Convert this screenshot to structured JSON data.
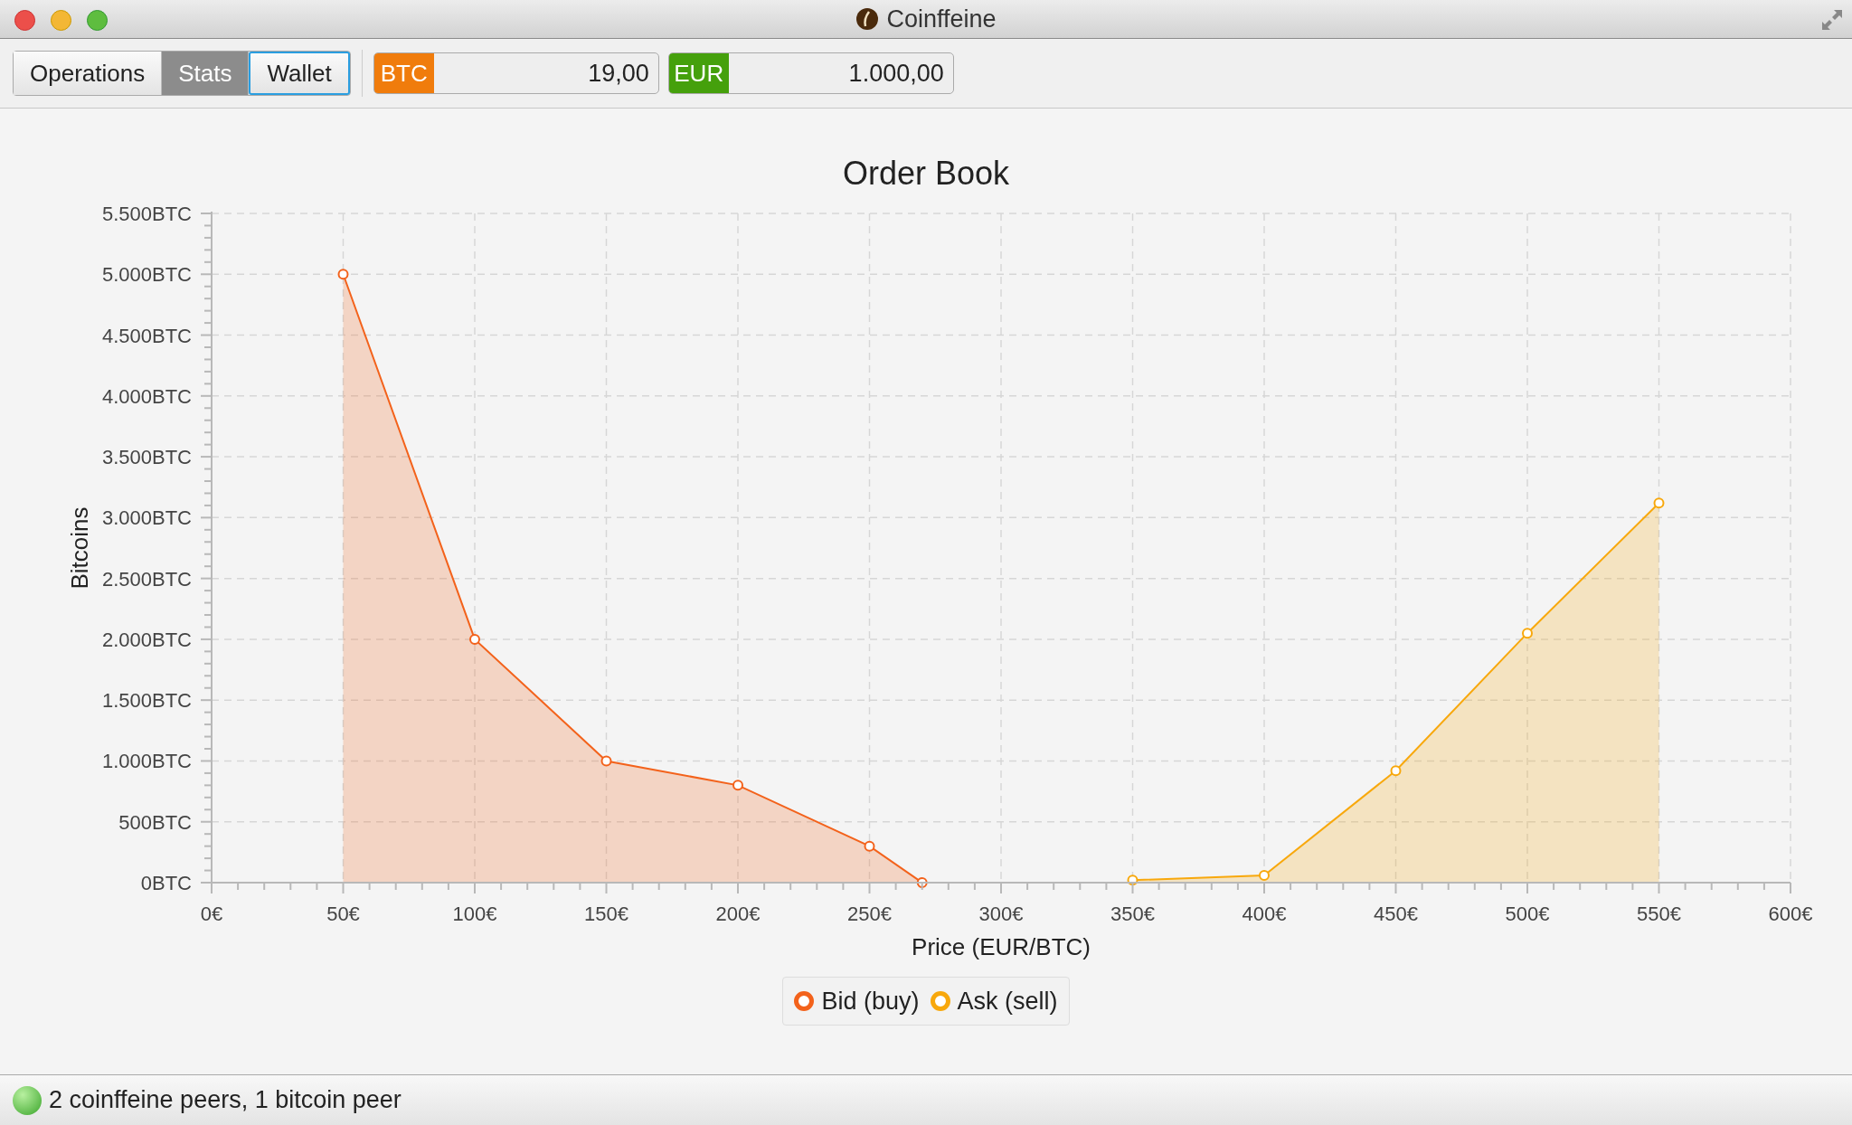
{
  "window": {
    "title": "Coinffeine"
  },
  "tabs": [
    {
      "label": "Operations",
      "selected": false,
      "focused": false
    },
    {
      "label": "Stats",
      "selected": true,
      "focused": false
    },
    {
      "label": "Wallet",
      "selected": false,
      "focused": true
    }
  ],
  "balances": [
    {
      "currency": "BTC",
      "amount": "19,00",
      "color": "#f07c0c"
    },
    {
      "currency": "EUR",
      "amount": "1.000,00",
      "color": "#45a00c"
    }
  ],
  "chart": {
    "chart_data": {
      "type": "area",
      "title": "Order Book",
      "xlabel": "Price (EUR/BTC)",
      "ylabel": "Bitcoins",
      "grid": true,
      "legend": "bottom",
      "xlim": [
        0,
        600
      ],
      "ylim": [
        0,
        5500
      ],
      "xticks": [
        {
          "value": 0,
          "label": "0€"
        },
        {
          "value": 50,
          "label": "50€"
        },
        {
          "value": 100,
          "label": "100€"
        },
        {
          "value": 150,
          "label": "150€"
        },
        {
          "value": 200,
          "label": "200€"
        },
        {
          "value": 250,
          "label": "250€"
        },
        {
          "value": 300,
          "label": "300€"
        },
        {
          "value": 350,
          "label": "350€"
        },
        {
          "value": 400,
          "label": "400€"
        },
        {
          "value": 450,
          "label": "450€"
        },
        {
          "value": 500,
          "label": "500€"
        },
        {
          "value": 550,
          "label": "550€"
        },
        {
          "value": 600,
          "label": "600€"
        }
      ],
      "yticks": [
        {
          "value": 0,
          "label": "0BTC"
        },
        {
          "value": 500,
          "label": "500BTC"
        },
        {
          "value": 1000,
          "label": "1.000BTC"
        },
        {
          "value": 1500,
          "label": "1.500BTC"
        },
        {
          "value": 2000,
          "label": "2.000BTC"
        },
        {
          "value": 2500,
          "label": "2.500BTC"
        },
        {
          "value": 3000,
          "label": "3.000BTC"
        },
        {
          "value": 3500,
          "label": "3.500BTC"
        },
        {
          "value": 4000,
          "label": "4.000BTC"
        },
        {
          "value": 4500,
          "label": "4.500BTC"
        },
        {
          "value": 5000,
          "label": "5.000BTC"
        },
        {
          "value": 5500,
          "label": "5.500BTC"
        }
      ],
      "series": [
        {
          "name": "Bid (buy)",
          "color": "#f3621b",
          "x": [
            50,
            100,
            150,
            200,
            250,
            270
          ],
          "values": [
            5000,
            2000,
            1000,
            800,
            300,
            0
          ]
        },
        {
          "name": "Ask (sell)",
          "color": "#f8a80c",
          "x": [
            350,
            400,
            450,
            500,
            550
          ],
          "values": [
            20,
            60,
            920,
            2050,
            3120
          ]
        }
      ]
    }
  },
  "status_bar": {
    "text": "2 coinffeine peers, 1 bitcoin peer"
  }
}
